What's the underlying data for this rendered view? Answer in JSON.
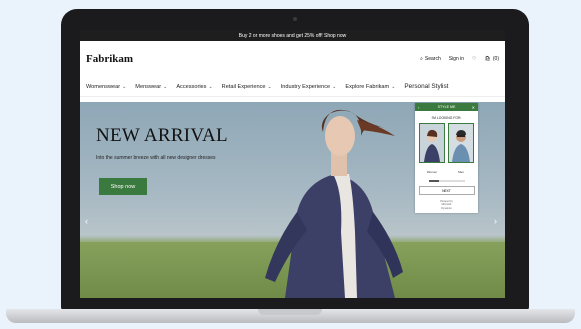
{
  "promo": {
    "text": "Buy 2 or more shoes and get 25% off!  Shop now"
  },
  "header": {
    "logo": "Fabrikam",
    "search_label": "Search",
    "signin_label": "Sign in",
    "cart_count": "(0)"
  },
  "nav": {
    "items": [
      {
        "label": "Womenswear"
      },
      {
        "label": "Menswear"
      },
      {
        "label": "Accessories"
      },
      {
        "label": "Retail Experience"
      },
      {
        "label": "Industry Experience"
      },
      {
        "label": "Explore Fabrikam"
      },
      {
        "label": "Personal Stylist"
      }
    ]
  },
  "hero": {
    "title": "NEW ARRIVAL",
    "subtitle": "Into the summer breeze with all new designer dresses",
    "cta": "Shop now",
    "prev": "‹",
    "next": "›"
  },
  "stylist": {
    "title": "STYLE ME",
    "question": "I'M LOOKING FOR:",
    "options": [
      {
        "label": "Women"
      },
      {
        "label": "Men"
      }
    ],
    "progress": 0.3,
    "next_label": "NEXT",
    "footer": "Powered by\nMicrosoft\nDynamics"
  },
  "colors": {
    "accent": "#3b7a3e",
    "promo_bg": "#1e1e1e"
  }
}
